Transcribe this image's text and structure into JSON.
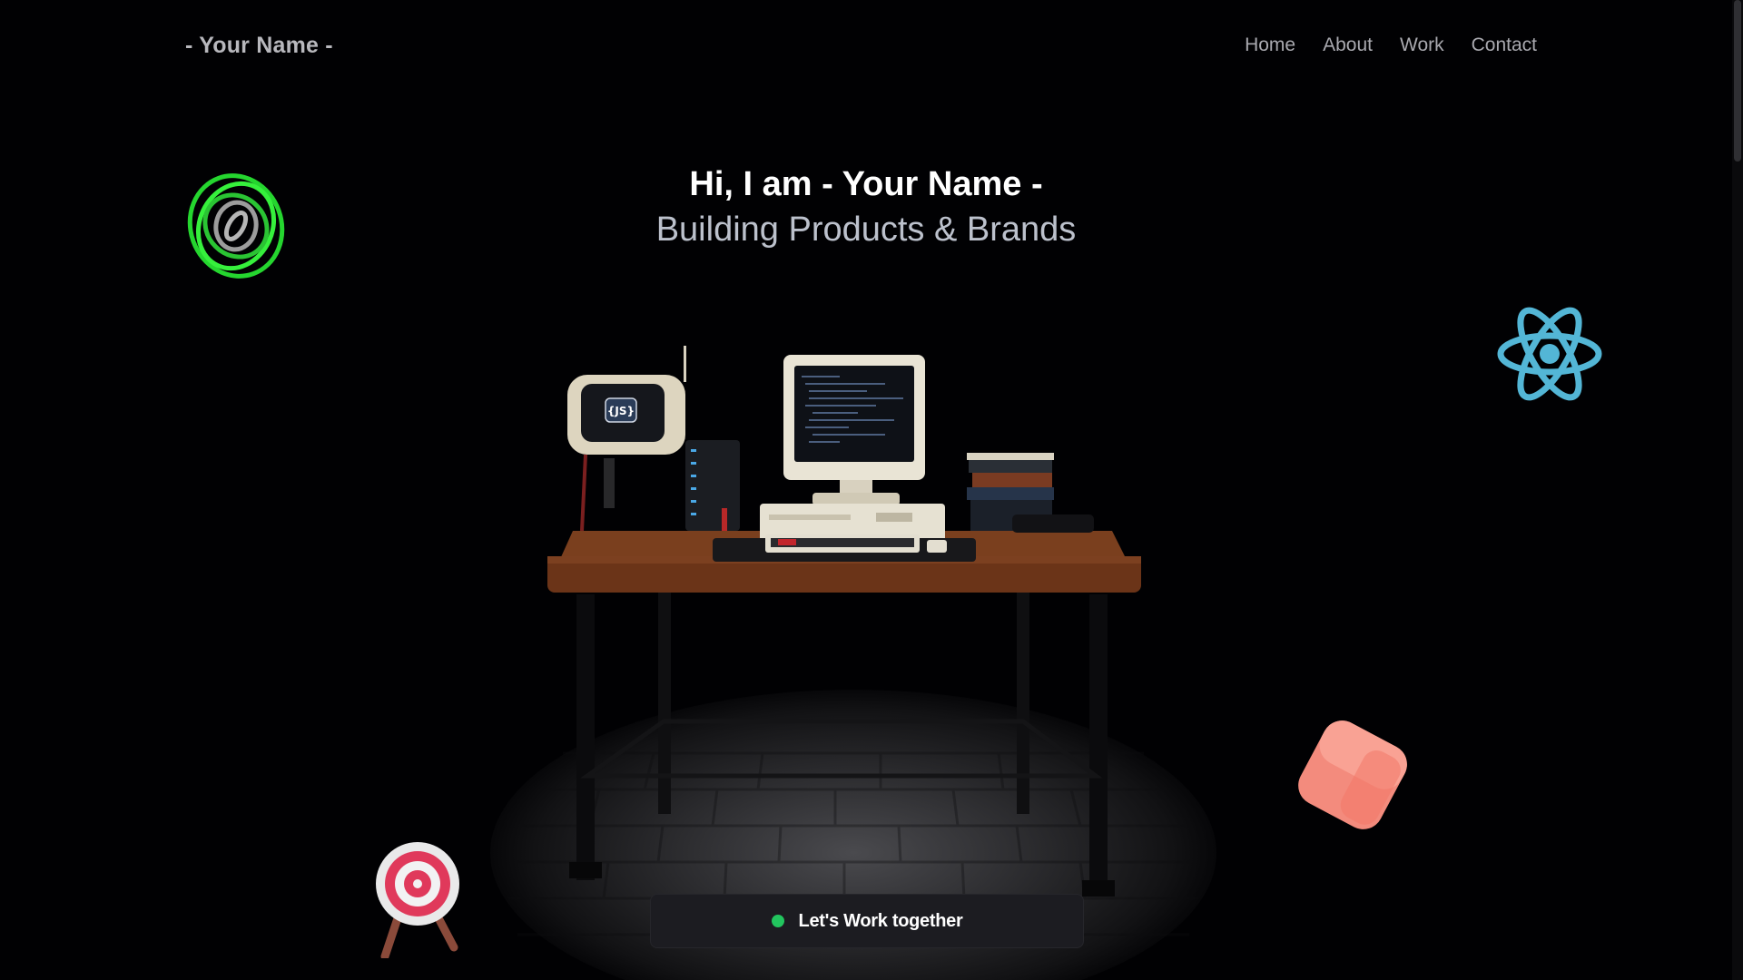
{
  "navbar": {
    "logo": "- Your Name -",
    "links": [
      "Home",
      "About",
      "Work",
      "Contact"
    ]
  },
  "hero": {
    "greeting": "Hi, I am - Your Name -",
    "tagline": "Building Products & Brands"
  },
  "desk_scene": {
    "tv_screen_text": "{JS}"
  },
  "floating_icons": [
    "rings-icon",
    "react-icon",
    "cube-icon",
    "target-icon"
  ],
  "cta": {
    "label": "Let's Work together",
    "status_color": "#22c55e"
  },
  "colors": {
    "background": "#010103",
    "react": "#53b6d6",
    "rings": "#2ee63a",
    "cube": "#f58a7c",
    "target": "#e0395b"
  }
}
